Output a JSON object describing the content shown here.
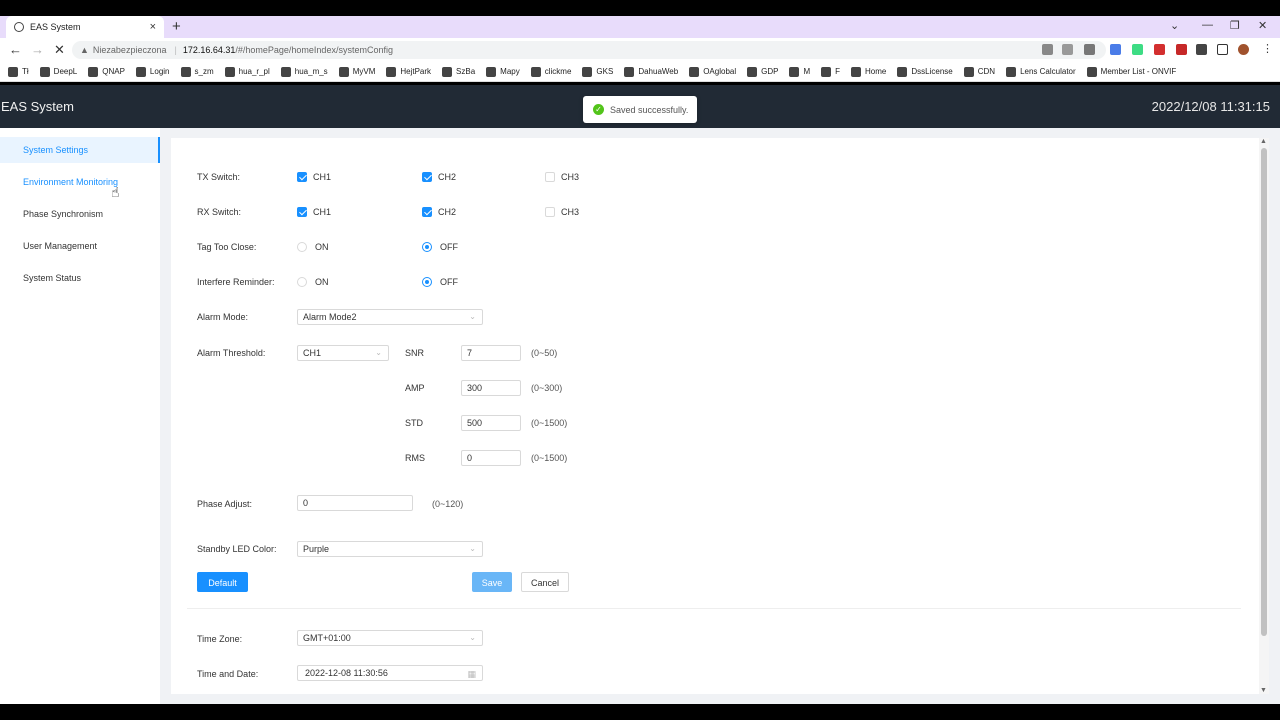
{
  "browser": {
    "tab_title": "EAS System",
    "tab_close": "×",
    "new_tab": "+",
    "security_label": "Niezabezpieczona",
    "url_host": "172.16.64.31",
    "url_path": "/#/homePage/homeIndex/systemConfig",
    "bookmarks": [
      "Tł",
      "DeepL",
      "QNAP",
      "Login",
      "s_zm",
      "hua_r_pl",
      "hua_m_s",
      "MyVM",
      "HejtPark",
      "SzBa",
      "Mapy",
      "clickme",
      "GKS",
      "DahuaWeb",
      "OAglobal",
      "GDP",
      "M",
      "F",
      "Home",
      "DssLicense",
      "CDN",
      "Lens Calculator",
      "Member List - ONVIF"
    ]
  },
  "header": {
    "title": "EAS System",
    "clock": "2022/12/08 11:31:15"
  },
  "toast": {
    "message": "Saved successfully."
  },
  "sidebar": {
    "items": [
      {
        "label": "System Settings",
        "active": true
      },
      {
        "label": "Environment Monitoring",
        "active": false
      },
      {
        "label": "Phase Synchronism",
        "active": false
      },
      {
        "label": "User Management",
        "active": false
      },
      {
        "label": "System Status",
        "active": false
      }
    ]
  },
  "form": {
    "tx_switch": {
      "label": "TX Switch:",
      "channels": [
        {
          "name": "CH1",
          "checked": true
        },
        {
          "name": "CH2",
          "checked": true
        },
        {
          "name": "CH3",
          "checked": false
        }
      ]
    },
    "rx_switch": {
      "label": "RX Switch:",
      "channels": [
        {
          "name": "CH1",
          "checked": true
        },
        {
          "name": "CH2",
          "checked": true
        },
        {
          "name": "CH3",
          "checked": false
        }
      ]
    },
    "tag_too_close": {
      "label": "Tag Too Close:",
      "on": "ON",
      "off": "OFF",
      "value": "OFF"
    },
    "interfere_reminder": {
      "label": "Interfere Reminder:",
      "on": "ON",
      "off": "OFF",
      "value": "OFF"
    },
    "alarm_mode": {
      "label": "Alarm Mode:",
      "value": "Alarm Mode2"
    },
    "alarm_threshold": {
      "label": "Alarm Threshold:",
      "channel": "CH1",
      "params": [
        {
          "name": "SNR",
          "value": "7",
          "range": "(0~50)"
        },
        {
          "name": "AMP",
          "value": "300",
          "range": "(0~300)"
        },
        {
          "name": "STD",
          "value": "500",
          "range": "(0~1500)"
        },
        {
          "name": "RMS",
          "value": "0",
          "range": "(0~1500)"
        }
      ]
    },
    "phase_adjust": {
      "label": "Phase Adjust:",
      "value": "0",
      "range": "(0~120)"
    },
    "standby_led": {
      "label": "Standby LED Color:",
      "value": "Purple"
    },
    "buttons": {
      "default": "Default",
      "save": "Save",
      "cancel": "Cancel"
    },
    "time_zone": {
      "label": "Time Zone:",
      "value": "GMT+01:00"
    },
    "time_date": {
      "label": "Time and Date:",
      "value": "2022-12-08 11:30:56"
    }
  },
  "colors": {
    "accent": "#1890ff",
    "header_bg": "#212a35",
    "success": "#52c41a"
  }
}
